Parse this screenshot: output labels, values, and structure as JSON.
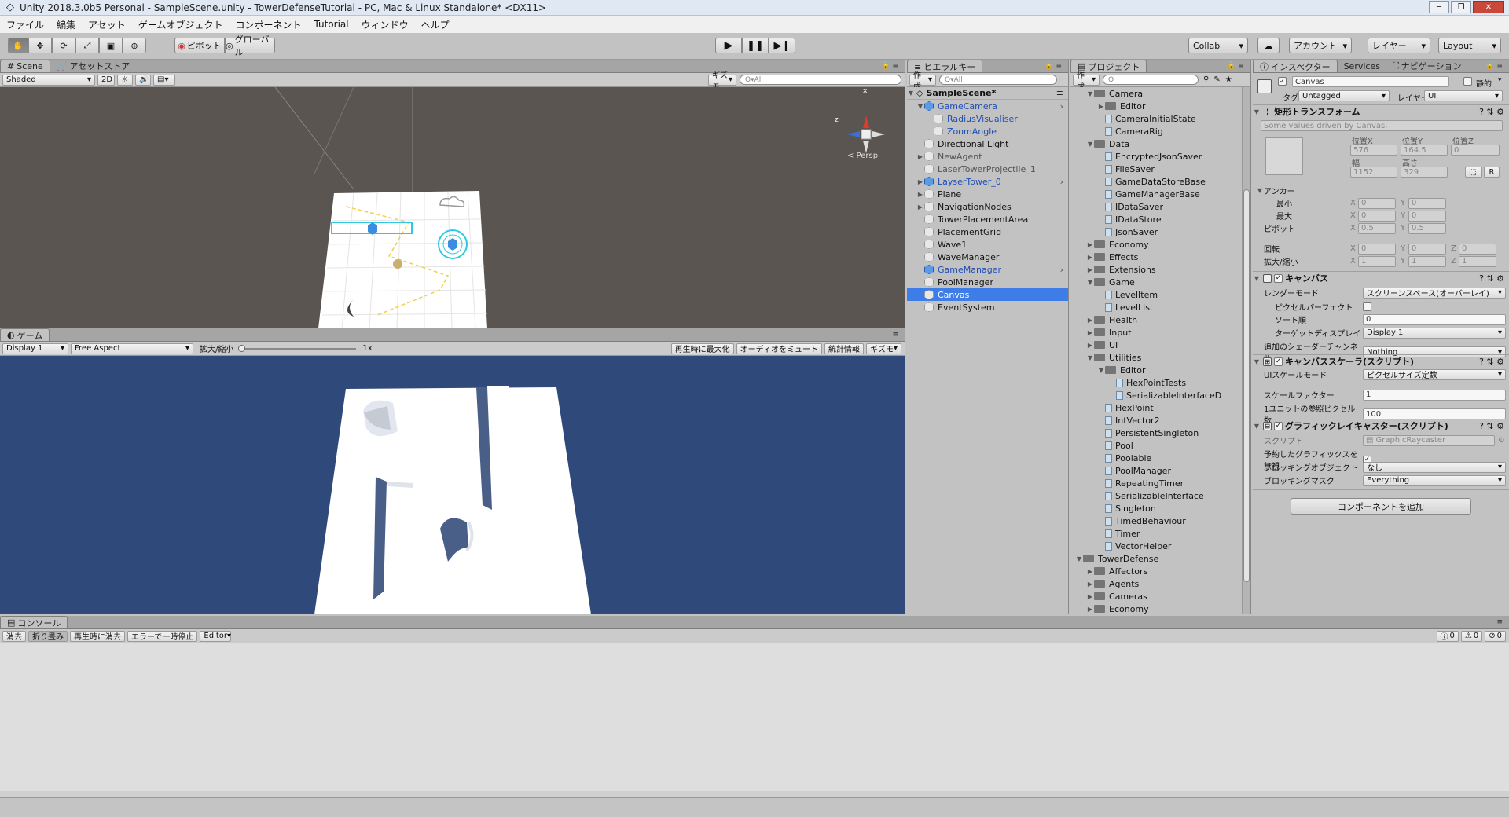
{
  "window": {
    "title": "Unity 2018.3.0b5 Personal - SampleScene.unity - TowerDefenseTutorial - PC, Mac & Linux Standalone* <DX11>"
  },
  "menu": [
    "ファイル",
    "編集",
    "アセット",
    "ゲームオブジェクト",
    "コンポーネント",
    "Tutorial",
    "ウィンドウ",
    "ヘルプ"
  ],
  "toolbar": {
    "pivot": "ピボット",
    "global": "グローバル",
    "collab": "Collab",
    "account": "アカウント",
    "layers": "レイヤー",
    "layout": "Layout"
  },
  "scene": {
    "tab": "Scene",
    "tab2": "アセットストア",
    "shading": "Shaded",
    "mode2d": "2D",
    "gizmos": "ギズモ",
    "search": "Q▾All",
    "persp": "< Persp",
    "axis_x": "x",
    "axis_y": "y",
    "axis_z": "z"
  },
  "game": {
    "tab": "ゲーム",
    "display": "Display 1",
    "aspect": "Free Aspect",
    "scale_label": "拡大/縮小",
    "scale_value": "1x",
    "maximize": "再生時に最大化",
    "mute": "オーディオをミュート",
    "stats": "統計情報",
    "gizmos": "ギズモ"
  },
  "hierarchy": {
    "tab": "ヒエラルキー",
    "create": "作成",
    "search": "Q▾All",
    "scene": "SampleScene*",
    "items": [
      {
        "label": "GameCamera",
        "indent": 1,
        "arrow": "▼",
        "icon": "blue",
        "color": "blue"
      },
      {
        "label": "RadiusVisualiser",
        "indent": 2,
        "arrow": "",
        "icon": "grey",
        "color": "blue"
      },
      {
        "label": "ZoomAngle",
        "indent": 2,
        "arrow": "",
        "icon": "grey",
        "color": "blue"
      },
      {
        "label": "Directional Light",
        "indent": 1,
        "arrow": "",
        "icon": "grey",
        "color": "black"
      },
      {
        "label": "NewAgent",
        "indent": 1,
        "arrow": "▶",
        "icon": "grey",
        "color": "grey"
      },
      {
        "label": "LaserTowerProjectile_1",
        "indent": 1,
        "arrow": "",
        "icon": "grey",
        "color": "grey"
      },
      {
        "label": "LayserTower_0",
        "indent": 1,
        "arrow": "▶",
        "icon": "blue",
        "color": "blue"
      },
      {
        "label": "Plane",
        "indent": 1,
        "arrow": "▶",
        "icon": "grey",
        "color": "black"
      },
      {
        "label": "NavigationNodes",
        "indent": 1,
        "arrow": "▶",
        "icon": "grey",
        "color": "black"
      },
      {
        "label": "TowerPlacementArea",
        "indent": 1,
        "arrow": "",
        "icon": "grey",
        "color": "black"
      },
      {
        "label": "PlacementGrid",
        "indent": 1,
        "arrow": "",
        "icon": "grey",
        "color": "black"
      },
      {
        "label": "Wave1",
        "indent": 1,
        "arrow": "",
        "icon": "grey",
        "color": "black"
      },
      {
        "label": "WaveManager",
        "indent": 1,
        "arrow": "",
        "icon": "grey",
        "color": "black"
      },
      {
        "label": "GameManager",
        "indent": 1,
        "arrow": "",
        "icon": "blue",
        "color": "blue"
      },
      {
        "label": "PoolManager",
        "indent": 1,
        "arrow": "",
        "icon": "grey",
        "color": "black"
      },
      {
        "label": "Canvas",
        "indent": 1,
        "arrow": "",
        "icon": "grey",
        "color": "white",
        "selected": true
      },
      {
        "label": "EventSystem",
        "indent": 1,
        "arrow": "",
        "icon": "grey",
        "color": "black"
      }
    ]
  },
  "project": {
    "tab": "プロジェクト",
    "create": "作成",
    "items": [
      {
        "label": "Camera",
        "indent": 2,
        "arrow": "▼",
        "type": "folder"
      },
      {
        "label": "Editor",
        "indent": 3,
        "arrow": "▶",
        "type": "folder"
      },
      {
        "label": "CameraInitialState",
        "indent": 3,
        "arrow": "",
        "type": "script"
      },
      {
        "label": "CameraRig",
        "indent": 3,
        "arrow": "",
        "type": "script"
      },
      {
        "label": "Data",
        "indent": 2,
        "arrow": "▼",
        "type": "folder"
      },
      {
        "label": "EncryptedJsonSaver",
        "indent": 3,
        "arrow": "",
        "type": "script"
      },
      {
        "label": "FileSaver",
        "indent": 3,
        "arrow": "",
        "type": "script"
      },
      {
        "label": "GameDataStoreBase",
        "indent": 3,
        "arrow": "",
        "type": "script"
      },
      {
        "label": "GameManagerBase",
        "indent": 3,
        "arrow": "",
        "type": "script"
      },
      {
        "label": "IDataSaver",
        "indent": 3,
        "arrow": "",
        "type": "script"
      },
      {
        "label": "IDataStore",
        "indent": 3,
        "arrow": "",
        "type": "script"
      },
      {
        "label": "JsonSaver",
        "indent": 3,
        "arrow": "",
        "type": "script"
      },
      {
        "label": "Economy",
        "indent": 2,
        "arrow": "▶",
        "type": "folder"
      },
      {
        "label": "Effects",
        "indent": 2,
        "arrow": "▶",
        "type": "folder"
      },
      {
        "label": "Extensions",
        "indent": 2,
        "arrow": "▶",
        "type": "folder"
      },
      {
        "label": "Game",
        "indent": 2,
        "arrow": "▼",
        "type": "folder"
      },
      {
        "label": "LevelItem",
        "indent": 3,
        "arrow": "",
        "type": "script"
      },
      {
        "label": "LevelList",
        "indent": 3,
        "arrow": "",
        "type": "script"
      },
      {
        "label": "Health",
        "indent": 2,
        "arrow": "▶",
        "type": "folder"
      },
      {
        "label": "Input",
        "indent": 2,
        "arrow": "▶",
        "type": "folder"
      },
      {
        "label": "UI",
        "indent": 2,
        "arrow": "▶",
        "type": "folder"
      },
      {
        "label": "Utilities",
        "indent": 2,
        "arrow": "▼",
        "type": "folder"
      },
      {
        "label": "Editor",
        "indent": 3,
        "arrow": "▼",
        "type": "folder"
      },
      {
        "label": "HexPointTests",
        "indent": 4,
        "arrow": "",
        "type": "script"
      },
      {
        "label": "SerializableInterfaceD",
        "indent": 4,
        "arrow": "",
        "type": "script"
      },
      {
        "label": "HexPoint",
        "indent": 3,
        "arrow": "",
        "type": "script"
      },
      {
        "label": "IntVector2",
        "indent": 3,
        "arrow": "",
        "type": "script"
      },
      {
        "label": "PersistentSingleton",
        "indent": 3,
        "arrow": "",
        "type": "script"
      },
      {
        "label": "Pool",
        "indent": 3,
        "arrow": "",
        "type": "script"
      },
      {
        "label": "Poolable",
        "indent": 3,
        "arrow": "",
        "type": "script"
      },
      {
        "label": "PoolManager",
        "indent": 3,
        "arrow": "",
        "type": "script"
      },
      {
        "label": "RepeatingTimer",
        "indent": 3,
        "arrow": "",
        "type": "script"
      },
      {
        "label": "SerializableInterface",
        "indent": 3,
        "arrow": "",
        "type": "script"
      },
      {
        "label": "Singleton",
        "indent": 3,
        "arrow": "",
        "type": "script"
      },
      {
        "label": "TimedBehaviour",
        "indent": 3,
        "arrow": "",
        "type": "script"
      },
      {
        "label": "Timer",
        "indent": 3,
        "arrow": "",
        "type": "script"
      },
      {
        "label": "VectorHelper",
        "indent": 3,
        "arrow": "",
        "type": "script"
      },
      {
        "label": "TowerDefense",
        "indent": 1,
        "arrow": "▼",
        "type": "folder"
      },
      {
        "label": "Affectors",
        "indent": 2,
        "arrow": "▶",
        "type": "folder"
      },
      {
        "label": "Agents",
        "indent": 2,
        "arrow": "▶",
        "type": "folder"
      },
      {
        "label": "Cameras",
        "indent": 2,
        "arrow": "▶",
        "type": "folder"
      },
      {
        "label": "Economy",
        "indent": 2,
        "arrow": "▶",
        "type": "folder"
      }
    ]
  },
  "inspector": {
    "tab": "インスペクター",
    "tab2": "Services",
    "tab3": "ナビゲーション",
    "object_name": "Canvas",
    "static": "静的",
    "tag_label": "タグ",
    "tag": "Untagged",
    "layer_label": "レイヤー",
    "layer": "UI",
    "rect": {
      "title": "矩形トランスフォーム",
      "note": "Some values driven by Canvas.",
      "posx_l": "位置X",
      "posy_l": "位置Y",
      "posz_l": "位置Z",
      "posx": "576",
      "posy": "164.5",
      "posz": "0",
      "w_l": "幅",
      "h_l": "高さ",
      "w": "1152",
      "h": "329",
      "r": "R",
      "anchor": "アンカー",
      "min": "最小",
      "max": "最大",
      "pivot": "ピボット",
      "rot": "回転",
      "scale": "拡大/縮小",
      "x": "X",
      "y": "Y",
      "z": "Z",
      "zero": "0",
      "one": "1",
      "half": "0.5"
    },
    "canvas": {
      "title": "キャンバス",
      "render_l": "レンダーモード",
      "render": "スクリーンスペース(オーバーレイ)",
      "pixel_l": "ピクセルパーフェクト",
      "sort_l": "ソート順",
      "sort": "0",
      "target_l": "ターゲットディスプレイ",
      "target": "Display 1",
      "shader_l": "追加のシェーダーチャンネル",
      "shader": "Nothing"
    },
    "scaler": {
      "title": "キャンバススケーラ(スクリプト)",
      "mode_l": "UIスケールモード",
      "mode": "ピクセルサイズ定数",
      "factor_l": "スケールファクター",
      "factor": "1",
      "ppu_l": "1ユニットの参照ピクセル数",
      "ppu": "100"
    },
    "raycaster": {
      "title": "グラフィックレイキャスター(スクリプト)",
      "script_l": "スクリプト",
      "script": "GraphicRaycaster",
      "ignore_l": "予約したグラフィックスを無視",
      "block_l": "ブロッキングオブジェクト",
      "block": "なし",
      "mask_l": "ブロッキングマスク",
      "mask": "Everything"
    },
    "add": "コンポーネントを追加"
  },
  "console": {
    "tab": "コンソール",
    "clear": "消去",
    "collapse": "折り畳み",
    "clear_play": "再生時に消去",
    "pause": "エラーで一時停止",
    "editor": "Editor",
    "info": "0",
    "warn": "0",
    "err": "0"
  },
  "colors": {
    "selection": "#3e7de7",
    "game_bg": "#2f4a7a",
    "scene_bg": "#5a5550"
  }
}
